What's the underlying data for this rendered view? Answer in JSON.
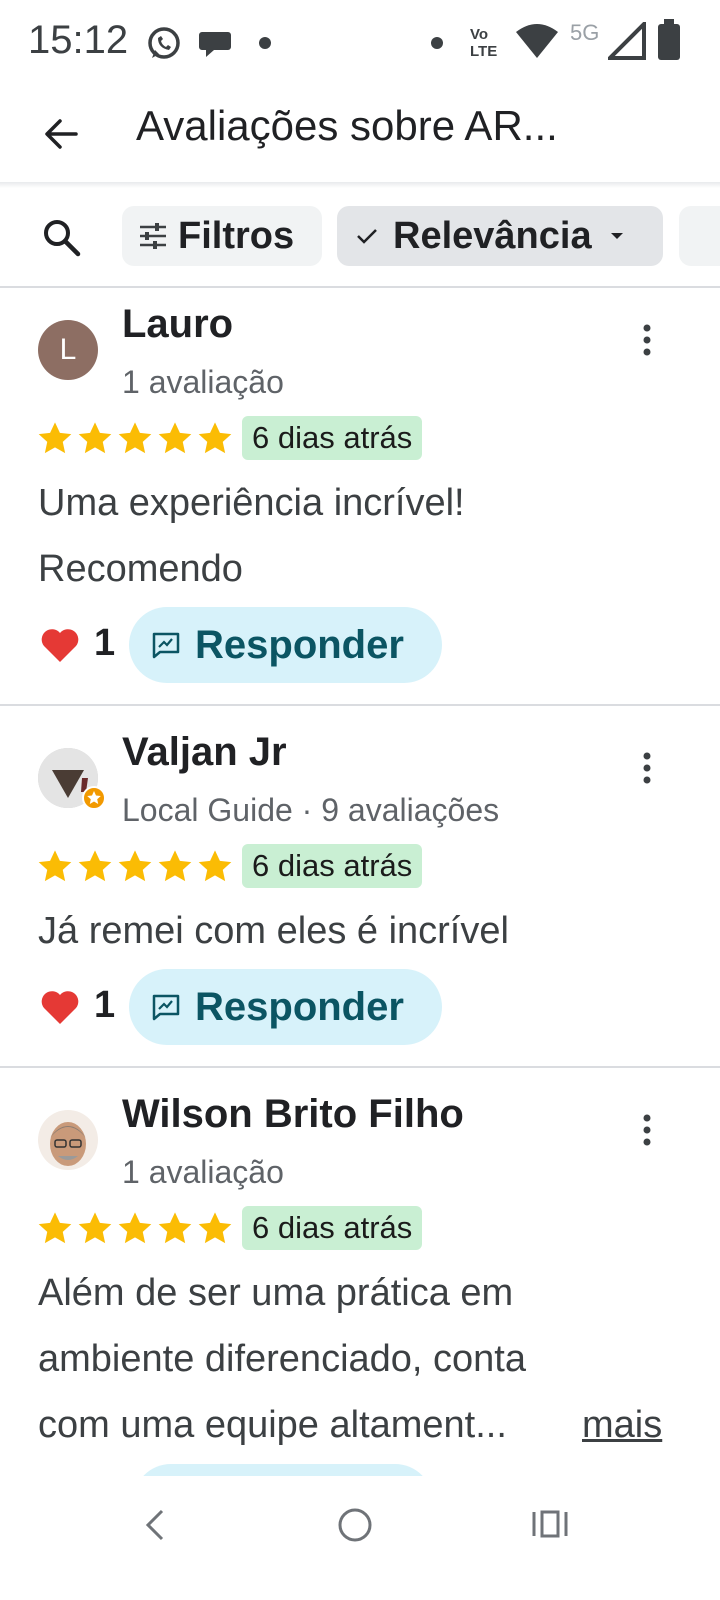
{
  "status_bar": {
    "time": "15:12",
    "network": "5G",
    "volte_top": "Vo",
    "volte_bottom": "LTE",
    "icons": [
      "whatsapp-icon",
      "chat-icon",
      "notification-dot-icon",
      "notification-dot-icon",
      "volte-icon",
      "wifi-icon",
      "signal-icon",
      "battery-icon"
    ]
  },
  "app_bar": {
    "title": "Avaliações sobre AR..."
  },
  "filters": {
    "filters_label": "Filtros",
    "sort_label": "Relevância"
  },
  "reviews": [
    {
      "name": "Lauro",
      "avatar_letter": "L",
      "meta": "1 avaliação",
      "rating": 5,
      "date": "6 dias atrás",
      "text_line1": "Uma experiência incrível!",
      "text_line2": "Recomendo",
      "likes": "1",
      "reply_label": "Responder"
    },
    {
      "name": "Valjan Jr",
      "meta": "Local Guide · 9 avaliações",
      "rating": 5,
      "date": "6 dias atrás",
      "text_line1": "Já remei com eles é incrível",
      "likes": "1",
      "reply_label": "Responder"
    },
    {
      "name": "Wilson Brito Filho",
      "meta": "1 avaliação",
      "rating": 5,
      "date": "6 dias atrás",
      "text_line1": "Além de ser uma prática em",
      "text_line2": "ambiente diferenciado, conta",
      "text_line3": "com uma equipe altament...",
      "more_label": "mais"
    }
  ],
  "colors": {
    "star": "#fbbc04",
    "date_badge": "#c9efd3",
    "reply_button": "#d7f2fa",
    "reply_text": "#0b5563",
    "heart": "#e53935"
  }
}
